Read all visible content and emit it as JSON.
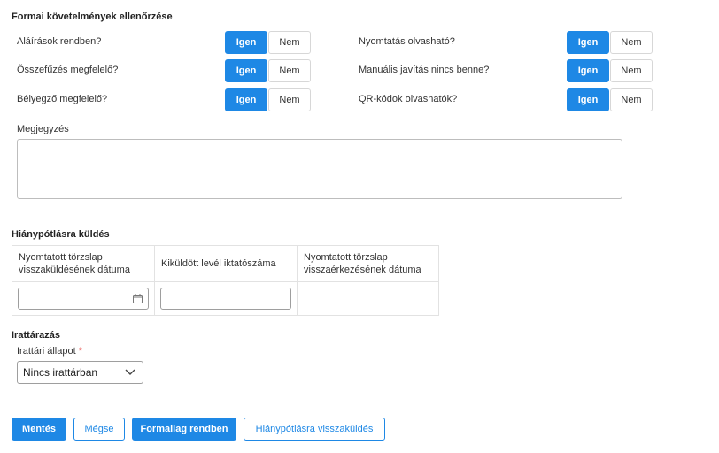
{
  "formai": {
    "title": "Formai követelmények ellenőrzése",
    "questions_left": [
      {
        "label": "Aláírások rendben?",
        "selected": "Igen"
      },
      {
        "label": "Összefűzés megfelelő?",
        "selected": "Igen"
      },
      {
        "label": "Bélyegző megfelelő?",
        "selected": "Igen"
      }
    ],
    "questions_right": [
      {
        "label": "Nyomtatás olvasható?",
        "selected": "Igen"
      },
      {
        "label": "Manuális javítás nincs benne?",
        "selected": "Igen"
      },
      {
        "label": "QR-kódok olvashatók?",
        "selected": "Igen"
      }
    ],
    "yes_label": "Igen",
    "no_label": "Nem",
    "note_label": "Megjegyzés",
    "note_value": ""
  },
  "hianypotlas": {
    "title": "Hiánypótlásra küldés",
    "columns": [
      "Nyomtatott törzslap visszaküldésének dátuma",
      "Kiküldött levél iktatószáma",
      "Nyomtatott törzslap visszaérkezésének dátuma"
    ],
    "date_value": "",
    "iktato_value": ""
  },
  "irattarazas": {
    "title": "Irattárazás",
    "status_label": "Irattári állapot",
    "required_mark": "*",
    "status_value": "Nincs irattárban"
  },
  "actions": {
    "save": "Mentés",
    "cancel": "Mégse",
    "formally_ok": "Formailag rendben",
    "send_back": "Hiánypótlásra visszaküldés"
  },
  "colors": {
    "primary": "#1e88e5",
    "required": "#e53935"
  }
}
